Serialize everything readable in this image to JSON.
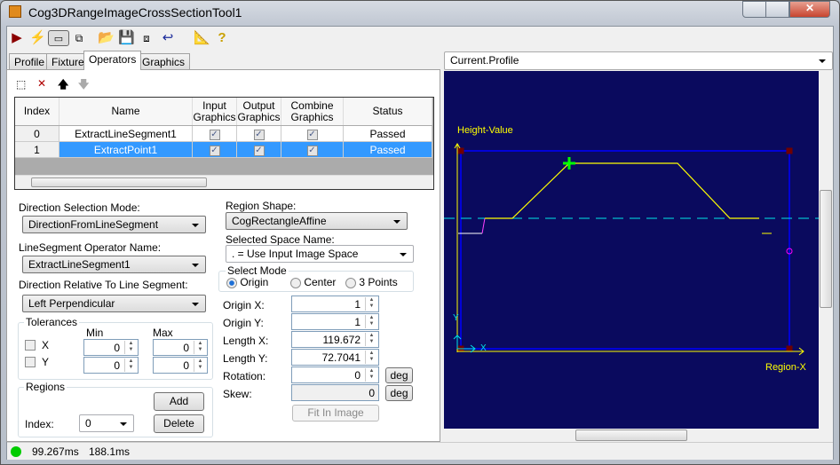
{
  "window": {
    "title": "Cog3DRangeImageCrossSectionTool1"
  },
  "toolbar": {
    "icons": [
      "run-icon",
      "electric-run-icon",
      "show-image-icon",
      "floating-window-icon",
      "open-icon",
      "save-icon",
      "save-as-icon",
      "reset-icon",
      "calibrate-icon",
      "help-icon"
    ]
  },
  "tabs": [
    {
      "label": "Profile"
    },
    {
      "label": "Fixture"
    },
    {
      "label": "Operators",
      "active": true
    },
    {
      "label": "Graphics"
    }
  ],
  "operators": {
    "columns": [
      "Index",
      "Name",
      "Input Graphics",
      "Output Graphics",
      "Combine Graphics",
      "Status"
    ],
    "rows": [
      {
        "index": "0",
        "name": "ExtractLineSegment1",
        "input": true,
        "output": true,
        "combine": true,
        "status": "Passed"
      },
      {
        "index": "1",
        "name": "ExtractPoint1",
        "input": true,
        "output": true,
        "combine": true,
        "status": "Passed",
        "selected": true
      }
    ]
  },
  "form": {
    "direction_mode_label": "Direction Selection Mode:",
    "direction_mode": "DirectionFromLineSegment",
    "lineseg_label": "LineSegment Operator Name:",
    "lineseg": "ExtractLineSegment1",
    "relative_label": "Direction Relative To Line Segment:",
    "relative": "Left Perpendicular",
    "tolerances": {
      "label": "Tolerances",
      "min": "Min",
      "max": "Max",
      "x": "X",
      "y": "Y",
      "x_min": "0",
      "x_max": "0",
      "y_min": "0",
      "y_max": "0"
    },
    "regions": {
      "label": "Regions",
      "add": "Add",
      "delete": "Delete",
      "index_label": "Index:",
      "index": "0"
    },
    "region_shape_label": "Region Shape:",
    "region_shape": "CogRectangleAffine",
    "space_label": "Selected Space Name:",
    "space": ". = Use Input Image Space",
    "select_mode": {
      "label": "Select Mode",
      "options": [
        "Origin",
        "Center",
        "3 Points"
      ],
      "selected": "Origin"
    },
    "origin_x_label": "Origin X:",
    "origin_x": "1",
    "origin_y_label": "Origin Y:",
    "origin_y": "1",
    "length_x_label": "Length X:",
    "length_x": "119.672",
    "length_y_label": "Length Y:",
    "length_y": "72.7041",
    "rotation_label": "Rotation:",
    "rotation": "0",
    "skew_label": "Skew:",
    "skew": "0",
    "deg": "deg",
    "fit": "Fit In Image"
  },
  "display": {
    "selector": "Current.Profile",
    "y_label": "Height-Value",
    "x_label": "Region-X",
    "axis_x": "X",
    "axis_y": "Y",
    "colors": {
      "background": "#0a0a5e",
      "profile": "#ffff00",
      "region": "#0000ff",
      "threshold": "#00e5e5",
      "point": "#00ff00"
    }
  },
  "status": {
    "time1": "99.267ms",
    "time2": "188.1ms",
    "indicator": "#00cc00"
  }
}
